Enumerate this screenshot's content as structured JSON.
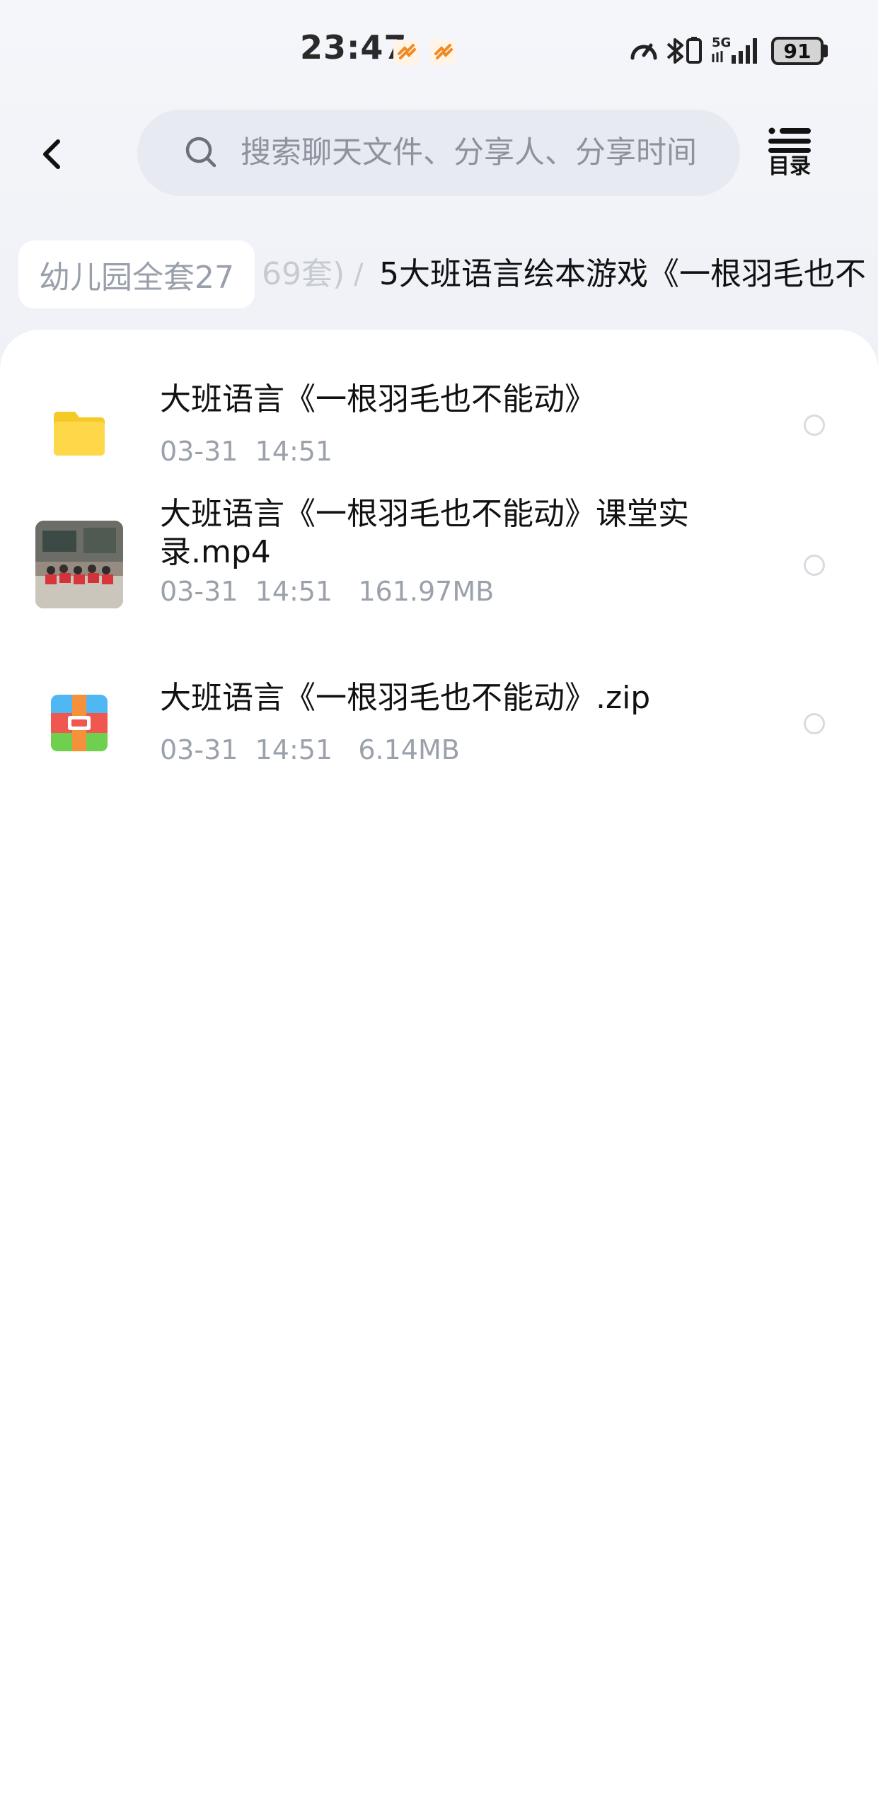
{
  "status_bar": {
    "time": "23:47",
    "network": "5G",
    "battery": "91"
  },
  "header": {
    "back_icon": "chevron-left-icon",
    "search_placeholder": "搜索聊天文件、分享人、分享时间",
    "toc_label": "目录"
  },
  "breadcrumb": {
    "root": "幼儿园全套27",
    "middle": "69套)",
    "separator": "/",
    "current": "5大班语言绘本游戏《一根羽毛也不"
  },
  "files": [
    {
      "icon": "folder-icon",
      "name": "大班语言《一根羽毛也不能动》",
      "date": "03-31",
      "time": "14:51",
      "size": ""
    },
    {
      "icon": "video-thumbnail",
      "name": "大班语言《一根羽毛也不能动》课堂实录.mp4",
      "date": "03-31",
      "time": "14:51",
      "size": "161.97MB"
    },
    {
      "icon": "zip-icon",
      "name": "大班语言《一根羽毛也不能动》.zip",
      "date": "03-31",
      "time": "14:51",
      "size": "6.14MB"
    }
  ],
  "colors": {
    "folder": "#ffd84a",
    "zip_blue": "#4fb7f2",
    "zip_orange": "#f5913b",
    "zip_red": "#f0574f",
    "zip_green": "#6fcf4e",
    "meta_text": "#9ba1ab"
  }
}
